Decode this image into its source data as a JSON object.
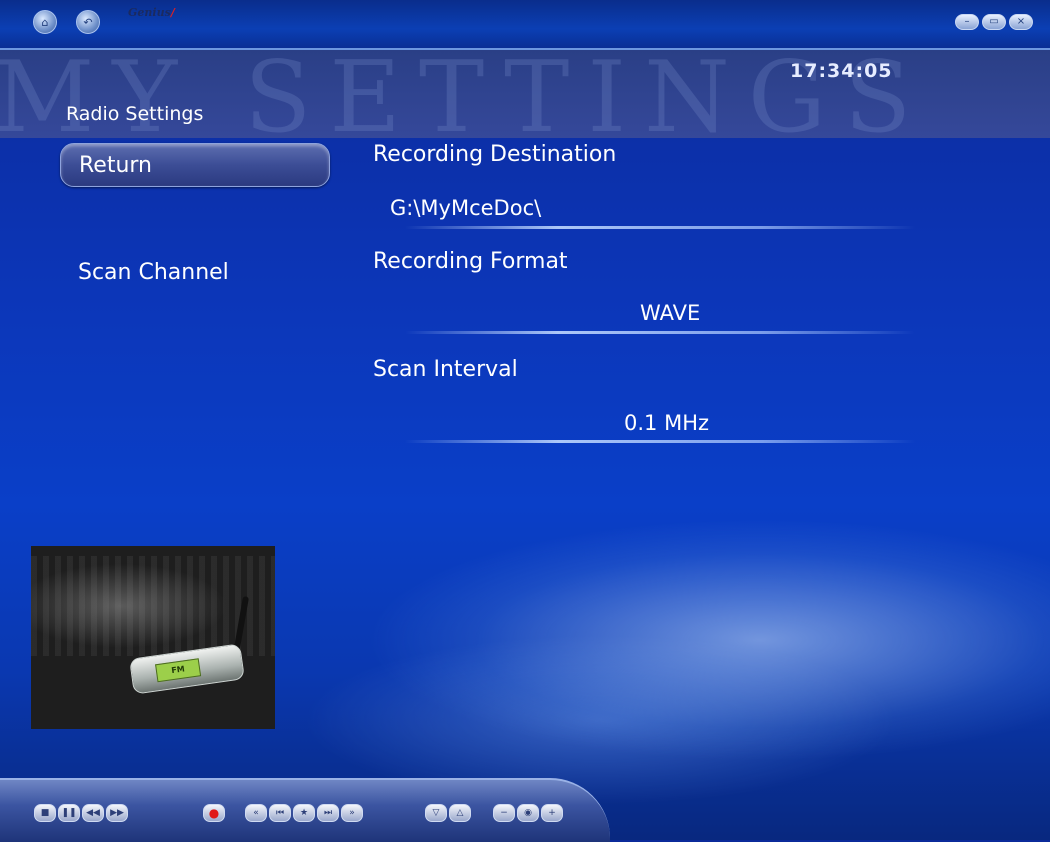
{
  "titlebar": {
    "brand": "Genius",
    "home_icon": "home-icon",
    "back_icon": "back-icon",
    "minimize_icon": "minimize-icon",
    "maximize_icon": "maximize-icon",
    "close_icon": "close-icon"
  },
  "header": {
    "watermark": "MY SETTINGS",
    "clock": "17:34:05",
    "page_title": "Radio Settings"
  },
  "menu": {
    "return_label": "Return",
    "scan_channel_label": "Scan Channel"
  },
  "settings": {
    "destination_label": "Recording Destination",
    "destination_value": "G:\\MyMceDoc\\",
    "format_label": "Recording Format",
    "format_value": "WAVE",
    "interval_label": "Scan Interval",
    "interval_value": "0.1 MHz"
  },
  "thumbnail": {
    "device_display": "FM"
  },
  "transport": {
    "buttons": [
      "stop-icon",
      "pause-icon",
      "rewind-icon",
      "fast-forward-icon",
      "record-icon",
      "skip-back-icon",
      "previous-icon",
      "favorite-icon",
      "next-icon",
      "skip-forward-icon",
      "channel-down-icon",
      "channel-up-icon",
      "volume-down-icon",
      "mute-icon",
      "volume-up-icon"
    ]
  },
  "colors": {
    "background": "#0a3fc8",
    "banner": "#35489a",
    "focus_button": "#3c4d96"
  }
}
